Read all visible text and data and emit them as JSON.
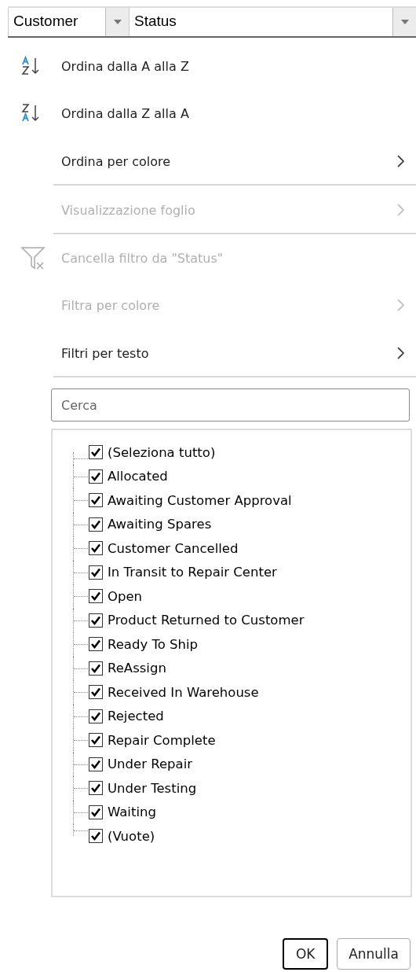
{
  "header": {
    "columns": [
      {
        "label": "Customer"
      },
      {
        "label": "Status"
      }
    ]
  },
  "menu": [
    {
      "label": "Ordina dalla A alla Z",
      "kind": "sort_asc",
      "disabled": false,
      "submenu": false,
      "divider_after": false
    },
    {
      "label": "Ordina dalla Z alla A",
      "kind": "sort_desc",
      "disabled": false,
      "submenu": false,
      "divider_after": false
    },
    {
      "label": "Ordina per colore",
      "disabled": false,
      "submenu": true,
      "divider_after": true
    },
    {
      "label": "Visualizzazione foglio",
      "disabled": true,
      "submenu": true,
      "divider_after": true
    },
    {
      "label": "Cancella filtro da \"Status\"",
      "kind": "clear_filter",
      "disabled": true,
      "submenu": false,
      "divider_after": false
    },
    {
      "label": "Filtra per colore",
      "disabled": true,
      "submenu": true,
      "divider_after": false
    },
    {
      "label": "Filtri per testo",
      "disabled": false,
      "submenu": true,
      "divider_after": true
    }
  ],
  "search": {
    "placeholder": "Cerca"
  },
  "values": [
    {
      "label": "(Seleziona tutto)",
      "checked": true
    },
    {
      "label": "Allocated",
      "checked": true
    },
    {
      "label": "Awaiting Customer Approval",
      "checked": true
    },
    {
      "label": "Awaiting Spares",
      "checked": true
    },
    {
      "label": "Customer Cancelled",
      "checked": true
    },
    {
      "label": "In Transit to Repair Center",
      "checked": true
    },
    {
      "label": "Open",
      "checked": true
    },
    {
      "label": "Product Returned to Customer",
      "checked": true
    },
    {
      "label": "Ready To Ship",
      "checked": true
    },
    {
      "label": "ReAssign",
      "checked": true
    },
    {
      "label": "Received In Warehouse",
      "checked": true
    },
    {
      "label": "Rejected",
      "checked": true
    },
    {
      "label": "Repair Complete",
      "checked": true
    },
    {
      "label": "Under Repair",
      "checked": true
    },
    {
      "label": "Under Testing",
      "checked": true
    },
    {
      "label": "Waiting",
      "checked": true
    },
    {
      "label": "(Vuote)",
      "checked": true
    }
  ],
  "buttons": [
    {
      "label": "OK",
      "default": true
    },
    {
      "label": "Annulla",
      "default": false
    }
  ]
}
